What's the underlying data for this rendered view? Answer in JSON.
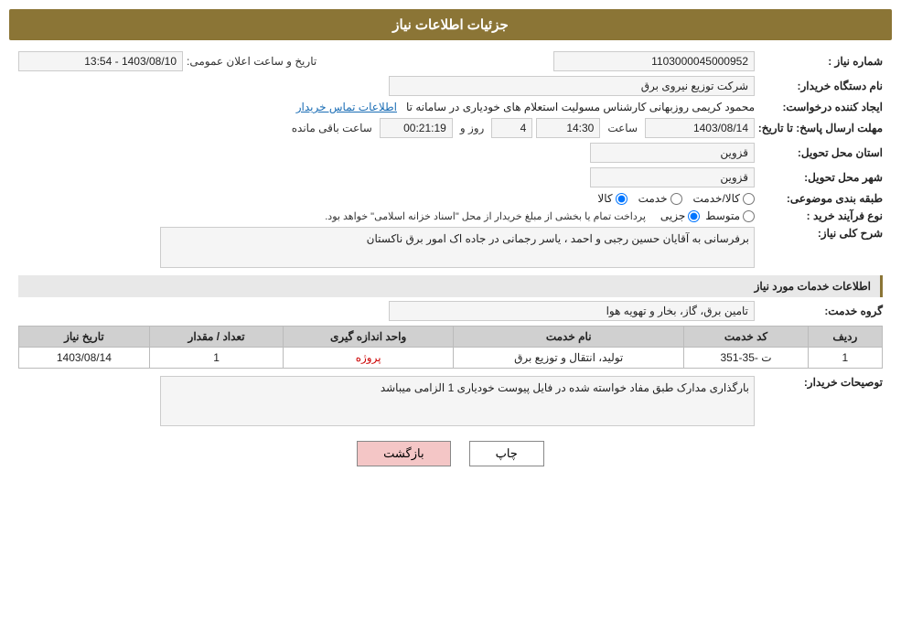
{
  "header": {
    "title": "جزئیات اطلاعات نیاز"
  },
  "fields": {
    "order_number_label": "شماره نیاز :",
    "order_number_value": "1103000045000952",
    "buyer_org_label": "نام دستگاه خریدار:",
    "buyer_org_value": "شرکت توزیع نیروی برق",
    "creator_label": "ایجاد کننده درخواست:",
    "creator_value": "محمود کریمی روزبهانی کارشناس  مسولیت استعلام های خودیاری در سامانه تا",
    "creator_link": "اطلاعات تماس خریدار",
    "deadline_label": "مهلت ارسال پاسخ: تا تاریخ:",
    "deadline_date": "1403/08/14",
    "deadline_time": "14:30",
    "deadline_days": "4",
    "deadline_days_label": "روز و",
    "deadline_remaining": "00:21:19",
    "deadline_remaining_label": "ساعت باقی مانده",
    "province_label": "استان محل تحویل:",
    "province_value": "قزوین",
    "city_label": "شهر محل تحویل:",
    "city_value": "قزوین",
    "category_label": "طبقه بندی موضوعی:",
    "category_options": [
      "کالا",
      "خدمت",
      "کالا/خدمت"
    ],
    "category_selected": "کالا",
    "process_label": "نوع فرآیند خرید :",
    "process_options": [
      "جزیی",
      "متوسط"
    ],
    "process_note": "پرداخت تمام یا بخشی از مبلغ خریدار از محل \"اسناد خزانه اسلامی\" خواهد بود.",
    "description_label": "شرح کلی نیاز:",
    "description_value": "برفرسانی به آقایان حسین رجبی و احمد ، یاسر رجمانی در جاده اک امور برق ناکستان",
    "services_section_label": "اطلاعات خدمات مورد نیاز",
    "service_group_label": "گروه خدمت:",
    "service_group_value": "تامین برق، گاز، بخار و تهویه هوا",
    "table": {
      "columns": [
        "ردیف",
        "کد خدمت",
        "نام خدمت",
        "واحد اندازه گیری",
        "تعداد / مقدار",
        "تاریخ نیاز"
      ],
      "rows": [
        {
          "row": "1",
          "code": "ت -35-351",
          "name": "تولید، انتقال و توزیع برق",
          "unit": "پروژه",
          "quantity": "1",
          "date": "1403/08/14"
        }
      ]
    },
    "buyer_notes_label": "توصیحات خریدار:",
    "buyer_notes_value": "بارگذاری مدارک طبق مفاد خواسته شده در فایل پیوست خودیاری 1 الزامی میباشد",
    "public_announce_label": "تاریخ و ساعت اعلان عمومی:",
    "public_announce_value": "1403/08/10 - 13:54"
  },
  "buttons": {
    "print_label": "چاپ",
    "back_label": "بازگشت"
  }
}
